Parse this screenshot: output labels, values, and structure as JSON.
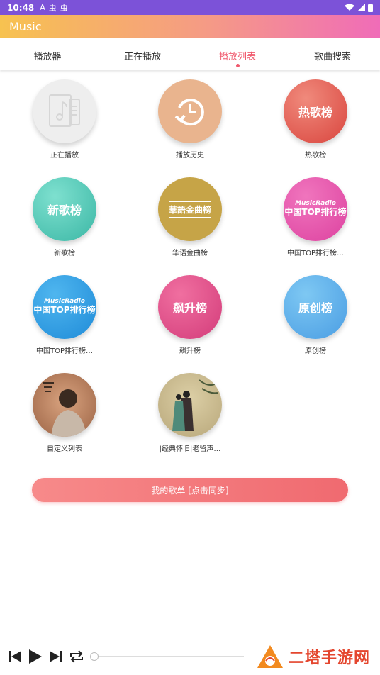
{
  "status_bar": {
    "time": "10:48",
    "notif_icons": [
      "A",
      "虫",
      "虫"
    ]
  },
  "app_bar": {
    "title": "Music"
  },
  "tabs": [
    {
      "label": "播放器"
    },
    {
      "label": "正在播放"
    },
    {
      "label": "播放列表",
      "active": true
    },
    {
      "label": "歌曲搜索"
    }
  ],
  "playlists": [
    {
      "label": "正在播放",
      "cover_text": "",
      "icon": "music-note-icon"
    },
    {
      "label": "播放历史",
      "cover_text": "",
      "icon": "history-clock-icon"
    },
    {
      "label": "热歌榜",
      "cover_text": "热歌榜"
    },
    {
      "label": "新歌榜",
      "cover_text": "新歌榜"
    },
    {
      "label": "华语金曲榜",
      "cover_text": "華語金曲榜"
    },
    {
      "label": "中国TOP排行榜…",
      "cover_text": "中国TOP排行榜",
      "cover_sub": "MusicRadio"
    },
    {
      "label": "中国TOP排行榜…",
      "cover_text": "中国TOP排行榜",
      "cover_sub": "MusicRadio"
    },
    {
      "label": "飙升榜",
      "cover_text": "飙升榜"
    },
    {
      "label": "原创榜",
      "cover_text": "原创榜"
    },
    {
      "label": "自定义列表",
      "cover_text": ""
    },
    {
      "label": "|经典怀旧|老留声…",
      "cover_text": ""
    }
  ],
  "sync_button": {
    "label": "我的歌单 [点击同步]"
  },
  "player": {
    "progress": 0
  },
  "watermark": {
    "text": "二塔手游网"
  },
  "colors": {
    "accent": "#f05a6e",
    "status_bar": "#7c52d8"
  }
}
